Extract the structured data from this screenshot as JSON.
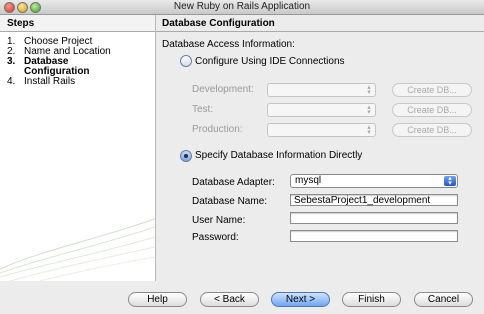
{
  "window": {
    "title": "New Ruby on Rails Application"
  },
  "steps": {
    "header": "Steps",
    "items": [
      {
        "num": "1.",
        "label": "Choose Project"
      },
      {
        "num": "2.",
        "label": "Name and Location"
      },
      {
        "num": "3.",
        "label": "Database Configuration"
      },
      {
        "num": "4.",
        "label": "Install Rails"
      }
    ]
  },
  "content": {
    "header": "Database Configuration",
    "access_label": "Database Access Information:",
    "ide": {
      "radio_label": "Configure Using IDE Connections",
      "rows": [
        {
          "label": "Development:",
          "button": "Create DB..."
        },
        {
          "label": "Test:",
          "button": "Create DB..."
        },
        {
          "label": "Production:",
          "button": "Create DB..."
        }
      ]
    },
    "direct": {
      "radio_label": "Specify Database Information Directly",
      "adapter_label": "Database Adapter:",
      "adapter_value": "mysql",
      "name_label": "Database Name:",
      "name_value": "SebestaProject1_development",
      "user_label": "User Name:",
      "user_value": "",
      "password_label": "Password:",
      "password_value": ""
    }
  },
  "buttons": {
    "help": "Help",
    "back": "< Back",
    "next": "Next >",
    "finish": "Finish",
    "cancel": "Cancel"
  }
}
